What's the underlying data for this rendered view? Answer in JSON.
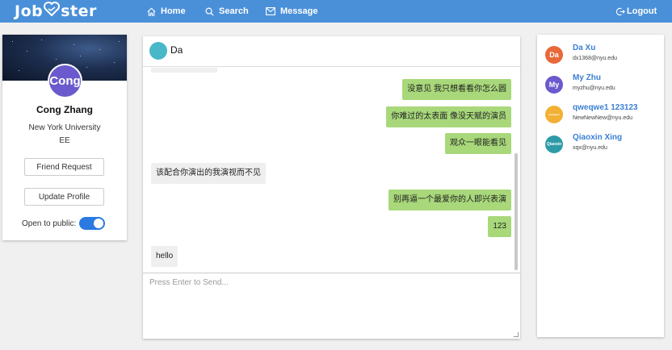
{
  "navbar": {
    "brand_left": "Job",
    "brand_right": "ster",
    "home": "Home",
    "search": "Search",
    "message": "Message",
    "logout": "Logout",
    "color": "#4a90d9"
  },
  "profile": {
    "avatar_text": "Cong",
    "name": "Cong Zhang",
    "university": "New York University",
    "major": "EE",
    "friend_request": "Friend Request",
    "update_profile": "Update Profile",
    "public_label": "Open to public:",
    "public_on": true
  },
  "chat": {
    "contact": "Da",
    "messages": [
      {
        "dir": "out",
        "text": "没意见 我只想看看你怎么圆"
      },
      {
        "dir": "out",
        "text": "你难过的太表面 像没天赋的演员"
      },
      {
        "dir": "out",
        "text": "观众一眼能看见"
      },
      {
        "dir": "in",
        "text": "该配合你演出的我演视而不见"
      },
      {
        "dir": "out",
        "text": "别再逼一个最爱你的人即兴表演"
      },
      {
        "dir": "out",
        "text": "123"
      },
      {
        "dir": "in",
        "text": "hello"
      }
    ],
    "input_placeholder": "Press Enter to Send..."
  },
  "friends": [
    {
      "initials": "Da",
      "name": "Da Xu",
      "email": "dx1368@nyu.edu",
      "color": "#e8683a"
    },
    {
      "initials": "My",
      "name": "My Zhu",
      "email": "myzhu@nyu.edu",
      "color": "#6a5acd"
    },
    {
      "initials": "qweqwe1",
      "name": "qweqwe1 123123",
      "email": "NewNewNew@nyu.edu",
      "color": "#f2b134"
    },
    {
      "initials": "Qiaoxin",
      "name": "Qiaoxin Xing",
      "email": "xqx@nyu.edu",
      "color": "#2e9aa8"
    }
  ]
}
